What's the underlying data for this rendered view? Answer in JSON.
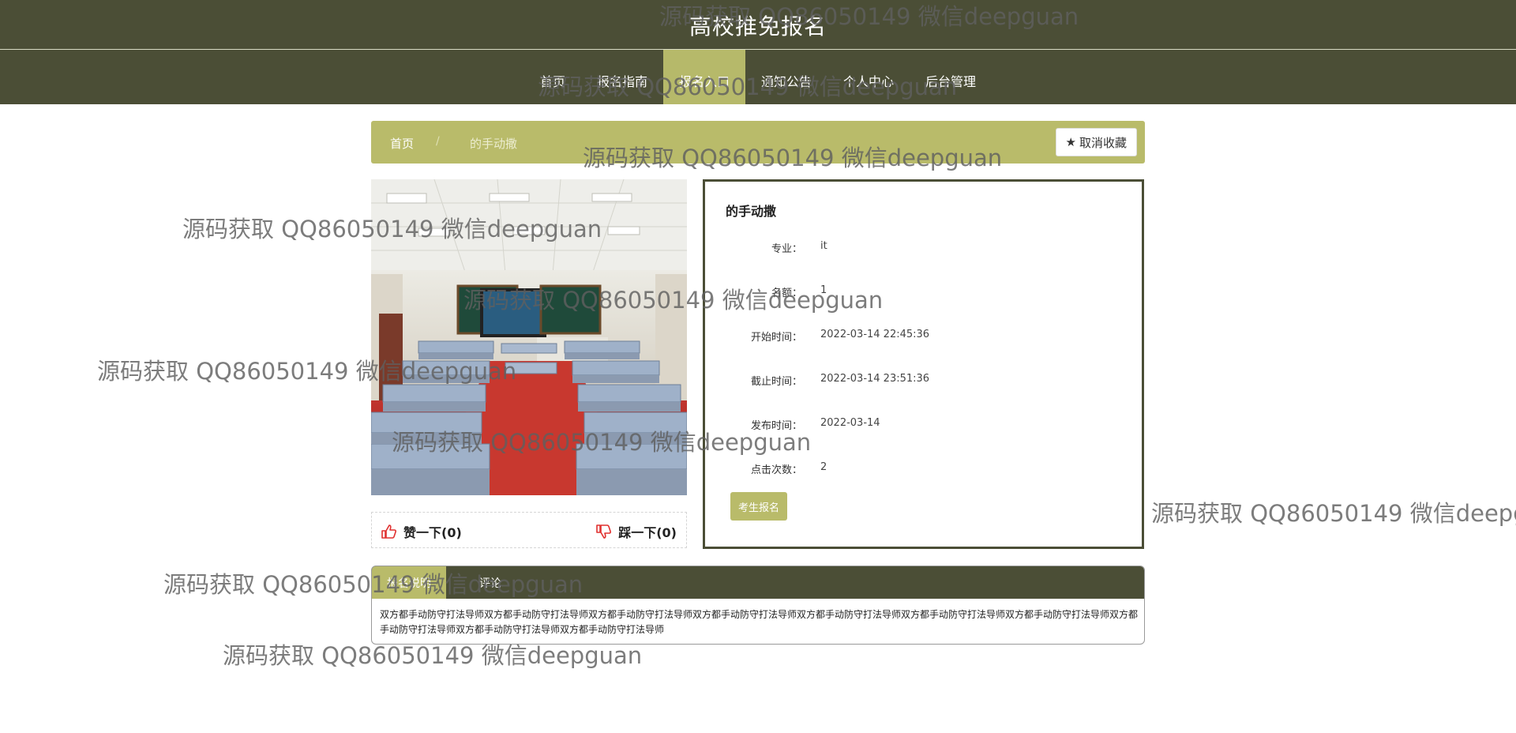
{
  "site": {
    "title": "高校推免报名"
  },
  "nav": {
    "items": [
      {
        "label": "首页",
        "active": false
      },
      {
        "label": "报名指南",
        "active": false
      },
      {
        "label": "报名入口",
        "active": true
      },
      {
        "label": "通知公告",
        "active": false
      },
      {
        "label": "个人中心",
        "active": false
      },
      {
        "label": "后台管理",
        "active": false
      }
    ]
  },
  "breadcrumb": {
    "home": "首页",
    "separator": "/",
    "current": "的手动撒",
    "favorite_label": "取消收藏",
    "favorite_icon": "star-icon"
  },
  "detail": {
    "title": "的手动撒",
    "fields": [
      {
        "label": "专业：",
        "value": "it"
      },
      {
        "label": "名额：",
        "value": "1"
      },
      {
        "label": "开始时间：",
        "value": "2022-03-14 22:45:36"
      },
      {
        "label": "截止时间：",
        "value": "2022-03-14 23:51:36"
      },
      {
        "label": "发布时间：",
        "value": "2022-03-14"
      },
      {
        "label": "点击次数：",
        "value": "2"
      }
    ],
    "signup_label": "考生报名"
  },
  "vote": {
    "like_label": "赞一下(0)",
    "dislike_label": "踩一下(0)",
    "like_icon": "thumbs-up-icon",
    "dislike_icon": "thumbs-down-icon"
  },
  "tabs": {
    "items": [
      "报名说明",
      "评论"
    ],
    "content": "双方都手动防守打法导师双方都手动防守打法导师双方都手动防守打法导师双方都手动防守打法导师双方都手动防守打法导师双方都手动防守打法导师双方都手动防守打法导师双方都手动防守打法导师双方都手动防守打法导师双方都手动防守打法导师"
  },
  "colors": {
    "header_bg": "#4b4e36",
    "accent": "#b9bb6a",
    "icon_red": "#e0302f"
  },
  "watermark": {
    "text": "源码获取 QQ86050149 微信deepguan"
  }
}
